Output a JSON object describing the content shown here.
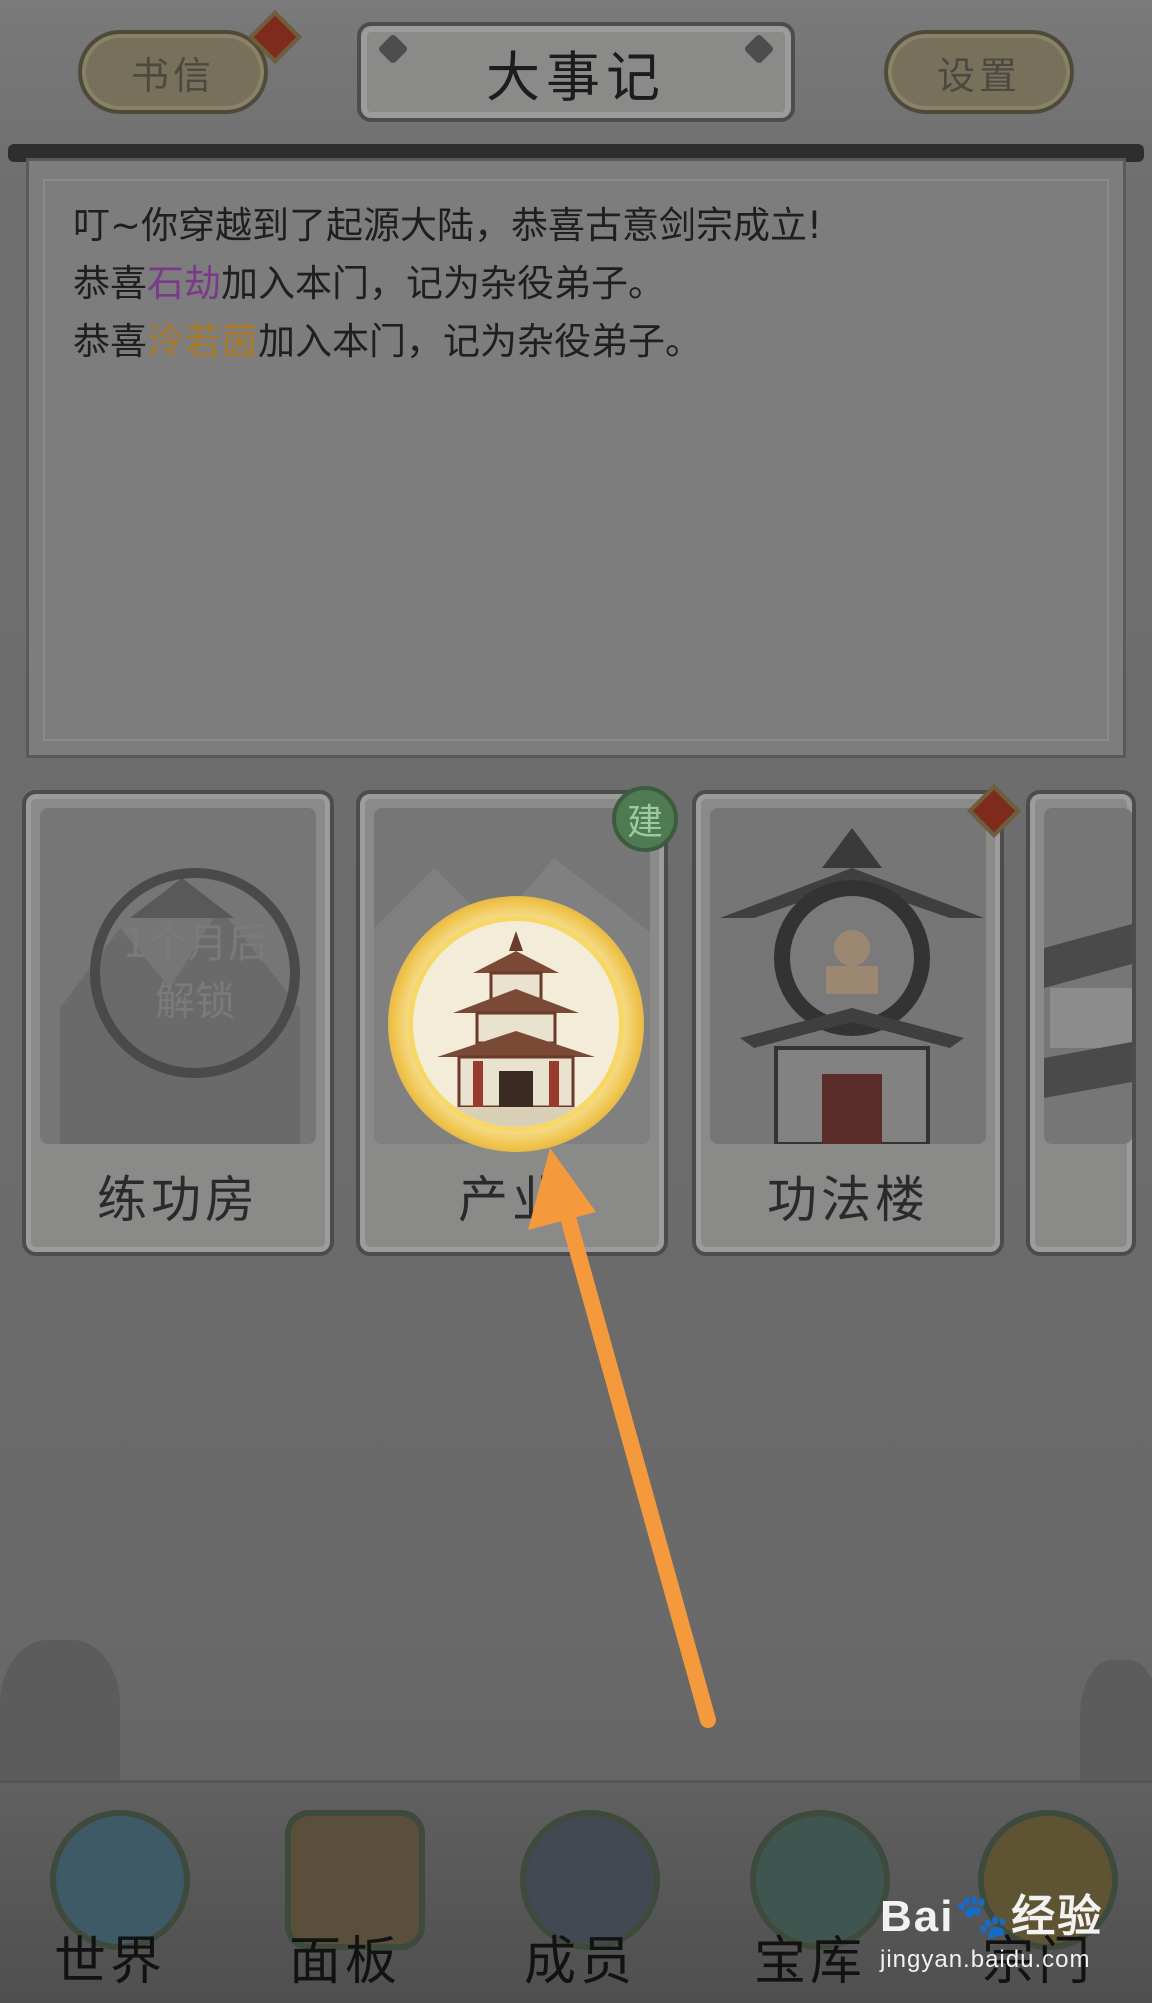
{
  "header": {
    "letters_label": "书信",
    "title": "大事记",
    "settings_label": "设置"
  },
  "log": {
    "line1": "叮~你穿越到了起源大陆，恭喜古意剑宗成立!",
    "line2_prefix": "恭喜",
    "line2_name": "石劫",
    "line2_suffix": "加入本门，记为杂役弟子。",
    "line3_prefix": "恭喜",
    "line3_name": "泠若茵",
    "line3_suffix": "加入本门，记为杂役弟子。"
  },
  "buildings": [
    {
      "label": "练功房",
      "lock_line1": "1个月后",
      "lock_line2": "解锁"
    },
    {
      "label": "产业",
      "badge": "建"
    },
    {
      "label": "功法楼"
    },
    {
      "label": ""
    }
  ],
  "nav": [
    {
      "label": "世界"
    },
    {
      "label": "面板"
    },
    {
      "label": "成员"
    },
    {
      "label": "宝库"
    },
    {
      "label": "宗门"
    }
  ],
  "watermark": {
    "brand": "Bai🐾经验",
    "url": "jingyan.baidu.com"
  },
  "colors": {
    "arrow": "#f59a3c",
    "highlight_glow": "#f0c34a",
    "name_purple": "#7a3a8a",
    "name_gold": "#a87a2a"
  }
}
